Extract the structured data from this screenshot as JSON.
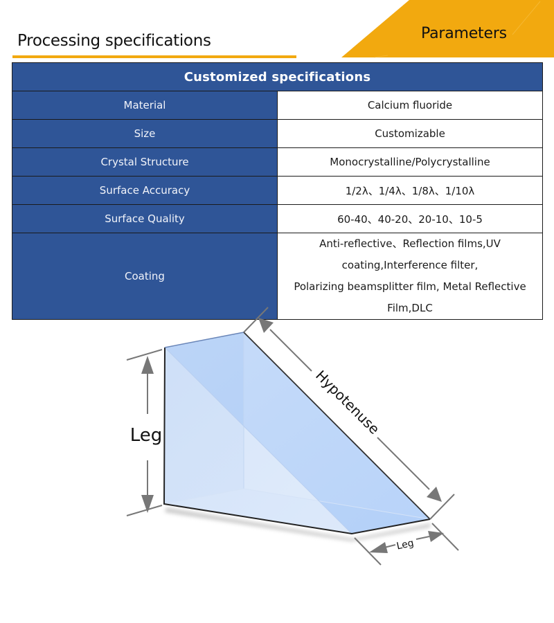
{
  "header": {
    "section_title": "Processing specifications",
    "tab_label": "Parameters",
    "accent_color": "#F2A90F"
  },
  "table": {
    "title": "Customized specifications",
    "header_color": "#2F5597",
    "rows": [
      {
        "key": "Material",
        "value": "Calcium fluoride"
      },
      {
        "key": "Size",
        "value": "Customizable"
      },
      {
        "key": "Crystal Structure",
        "value": "Monocrystalline/Polycrystalline"
      },
      {
        "key": "Surface Accuracy",
        "value": "1/2λ、1/4λ、1/8λ、1/10λ"
      },
      {
        "key": "Surface Quality",
        "value": "60-40、40-20、20-10、10-5"
      },
      {
        "key": "Coating",
        "value_lines": [
          "Anti-reflective、Reflection films,UV coating,Interference filter,",
          "Polarizing beamsplitter film, Metal Reflective Film,DLC"
        ]
      }
    ]
  },
  "diagram": {
    "subject": "right-angle prism",
    "labels": {
      "leg_vertical": "Leg",
      "hypotenuse": "Hypotenuse",
      "leg_bottom": "Leg"
    }
  }
}
